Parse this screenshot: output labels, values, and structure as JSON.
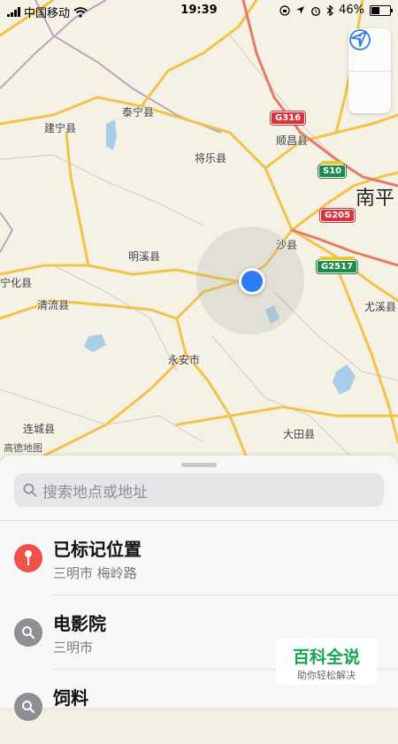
{
  "status_bar": {
    "carrier": "中国移动",
    "time": "19:39",
    "battery": "46%",
    "battery_level": 0.46
  },
  "map": {
    "cities": [
      {
        "name": "泰宁县"
      },
      {
        "name": "建宁县"
      },
      {
        "name": "顺昌县"
      },
      {
        "name": "将乐县"
      },
      {
        "name": "南平"
      },
      {
        "name": "沙县"
      },
      {
        "name": "明溪县"
      },
      {
        "name": "宁化县"
      },
      {
        "name": "清流县"
      },
      {
        "name": "尤溪县"
      },
      {
        "name": "永安市"
      },
      {
        "name": "连城县"
      },
      {
        "name": "大田县"
      }
    ],
    "shields": [
      {
        "code": "G316",
        "color": "red"
      },
      {
        "code": "S10",
        "color": "green"
      },
      {
        "code": "G205",
        "color": "red"
      },
      {
        "code": "G2517",
        "color": "green"
      }
    ],
    "attribution": "高德地图",
    "info_button": "info-icon",
    "location_button": "location-arrow-icon"
  },
  "sheet": {
    "search_placeholder": "搜索地点或地址",
    "items": [
      {
        "title": "已标记位置",
        "subtitle": "三明市 梅岭路",
        "icon": "pin-icon",
        "color": "#f0524a"
      },
      {
        "title": "电影院",
        "subtitle": "三明市",
        "icon": "search-icon",
        "color": "#8e8e93"
      },
      {
        "title": "饲料",
        "subtitle": "",
        "icon": "search-icon",
        "color": "#8e8e93"
      }
    ]
  },
  "watermark": {
    "title": "百科全说",
    "subtitle": "助你轻松解决"
  }
}
